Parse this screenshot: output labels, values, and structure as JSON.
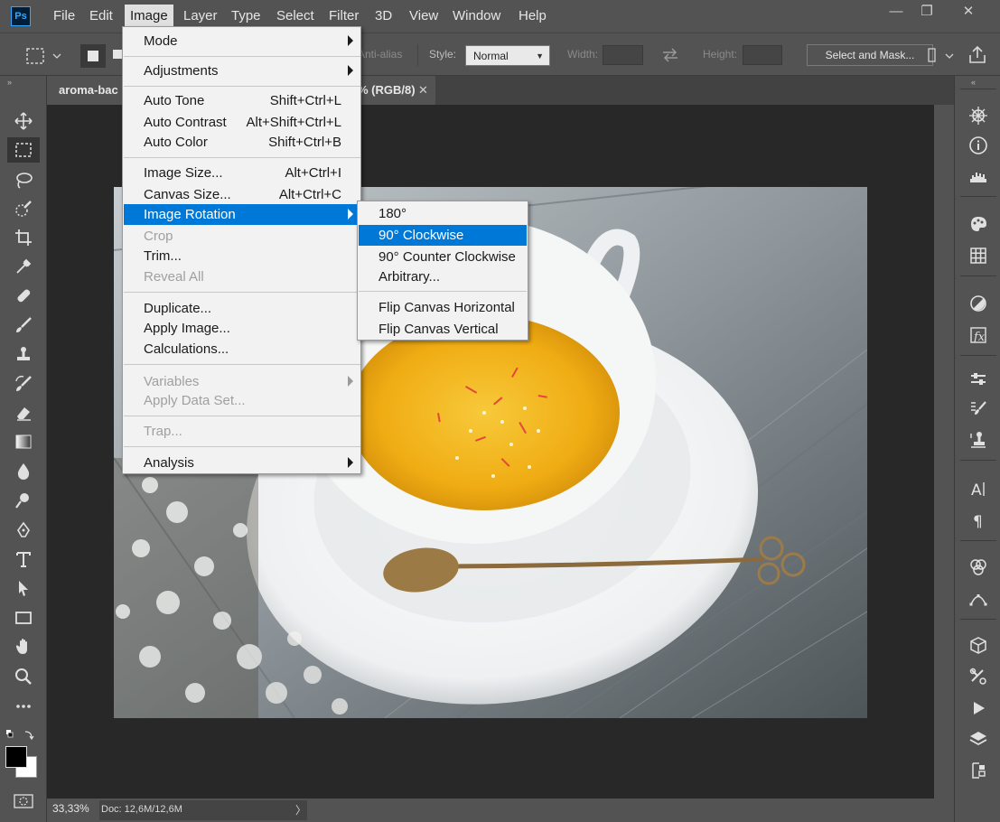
{
  "app": {
    "logo": "Ps"
  },
  "menubar": {
    "items": [
      "File",
      "Edit",
      "Image",
      "Layer",
      "Type",
      "Select",
      "Filter",
      "3D",
      "View",
      "Window",
      "Help"
    ],
    "active": "Image"
  },
  "window_controls": {
    "minimize": "—",
    "restore": "❐",
    "close": "✕"
  },
  "options_bar": {
    "anti_alias_label": "Anti-alias",
    "style_label": "Style:",
    "style_value": "Normal",
    "width_label": "Width:",
    "height_label": "Height:",
    "select_and_mask_label": "Select and Mask..."
  },
  "document": {
    "tab_title_start": "aroma-bac",
    "tab_title_end": "% (RGB/8)",
    "tab_close": "✕"
  },
  "status_bar": {
    "zoom": "33,33%",
    "doc_info": "Doc: 12,6M/12,6M",
    "arrow": "〉"
  },
  "image_menu": {
    "items": [
      {
        "label": "Mode",
        "shortcut": "",
        "submenu": true,
        "disabled": false
      },
      {
        "label": "Adjustments",
        "shortcut": "",
        "submenu": true,
        "disabled": false
      },
      {
        "label": "Auto Tone",
        "shortcut": "Shift+Ctrl+L",
        "submenu": false,
        "disabled": false
      },
      {
        "label": "Auto Contrast",
        "shortcut": "Alt+Shift+Ctrl+L",
        "submenu": false,
        "disabled": false
      },
      {
        "label": "Auto Color",
        "shortcut": "Shift+Ctrl+B",
        "submenu": false,
        "disabled": false
      },
      {
        "label": "Image Size...",
        "shortcut": "Alt+Ctrl+I",
        "submenu": false,
        "disabled": false
      },
      {
        "label": "Canvas Size...",
        "shortcut": "Alt+Ctrl+C",
        "submenu": false,
        "disabled": false
      },
      {
        "label": "Image Rotation",
        "shortcut": "",
        "submenu": true,
        "disabled": false,
        "highlighted": true
      },
      {
        "label": "Crop",
        "shortcut": "",
        "submenu": false,
        "disabled": true
      },
      {
        "label": "Trim...",
        "shortcut": "",
        "submenu": false,
        "disabled": false
      },
      {
        "label": "Reveal All",
        "shortcut": "",
        "submenu": false,
        "disabled": true
      },
      {
        "label": "Duplicate...",
        "shortcut": "",
        "submenu": false,
        "disabled": false
      },
      {
        "label": "Apply Image...",
        "shortcut": "",
        "submenu": false,
        "disabled": false
      },
      {
        "label": "Calculations...",
        "shortcut": "",
        "submenu": false,
        "disabled": false
      },
      {
        "label": "Variables",
        "shortcut": "",
        "submenu": true,
        "disabled": true
      },
      {
        "label": "Apply Data Set...",
        "shortcut": "",
        "submenu": false,
        "disabled": true
      },
      {
        "label": "Trap...",
        "shortcut": "",
        "submenu": false,
        "disabled": true
      },
      {
        "label": "Analysis",
        "shortcut": "",
        "submenu": true,
        "disabled": false
      }
    ]
  },
  "rotation_submenu": {
    "items": [
      {
        "label": "180°",
        "highlighted": false
      },
      {
        "label": "90° Clockwise",
        "highlighted": true
      },
      {
        "label": "90° Counter Clockwise",
        "highlighted": false
      },
      {
        "label": "Arbitrary...",
        "highlighted": false
      },
      {
        "label": "Flip Canvas Horizontal",
        "highlighted": false
      },
      {
        "label": "Flip Canvas Vertical",
        "highlighted": false
      }
    ]
  },
  "colors": {
    "ui_background": "#535353",
    "canvas_background": "#282828",
    "menu_highlight": "#0078d7",
    "menu_background": "#f2f2f2"
  },
  "tools": [
    "move-icon",
    "marquee-icon",
    "lasso-icon",
    "quick-select-icon",
    "crop-icon",
    "eyedropper-icon",
    "healing-icon",
    "brush-icon",
    "stamp-icon",
    "history-brush-icon",
    "eraser-icon",
    "gradient-icon",
    "blur-icon",
    "dodge-icon",
    "pen-icon",
    "type-icon",
    "path-select-icon",
    "rectangle-icon",
    "hand-icon",
    "zoom-icon",
    "more-tools-icon"
  ],
  "right_panels": [
    "navigator-icon",
    "info-icon",
    "histogram-icon",
    "color-icon",
    "swatches-icon",
    "adjustments-icon",
    "styles-icon",
    "properties-icon",
    "brush-settings-icon",
    "clone-source-icon",
    "character-icon",
    "paragraph-icon",
    "channels-icon",
    "paths-icon",
    "3d-icon",
    "tool-presets-icon",
    "actions-icon",
    "layers-icon",
    "layer-comps-icon"
  ]
}
